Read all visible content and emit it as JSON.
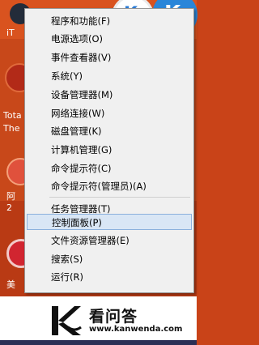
{
  "desktop": {
    "icon_labels": [
      "iT",
      "Tota",
      "The",
      "阿",
      "2",
      "美"
    ],
    "tile_glyphs": [
      "K",
      "K"
    ]
  },
  "context_menu": {
    "items": [
      {
        "label": "程序和功能(F)"
      },
      {
        "label": "电源选项(O)"
      },
      {
        "label": "事件查看器(V)"
      },
      {
        "label": "系统(Y)"
      },
      {
        "label": "设备管理器(M)"
      },
      {
        "label": "网络连接(W)"
      },
      {
        "label": "磁盘管理(K)"
      },
      {
        "label": "计算机管理(G)"
      },
      {
        "label": "命令提示符(C)"
      },
      {
        "label": "命令提示符(管理员)(A)"
      },
      {
        "label": "任务管理器(T)"
      },
      {
        "label": "控制面板(P)",
        "highlighted": true
      },
      {
        "label": "文件资源管理器(E)"
      },
      {
        "label": "搜索(S)"
      },
      {
        "label": "运行(R)"
      }
    ]
  },
  "watermark": {
    "title": "看问答",
    "url": "www.kanwenda.com"
  },
  "colors": {
    "menu_bg": "#f0f0f0",
    "highlight": "#d9e6f5",
    "desktop": "#c94318"
  }
}
